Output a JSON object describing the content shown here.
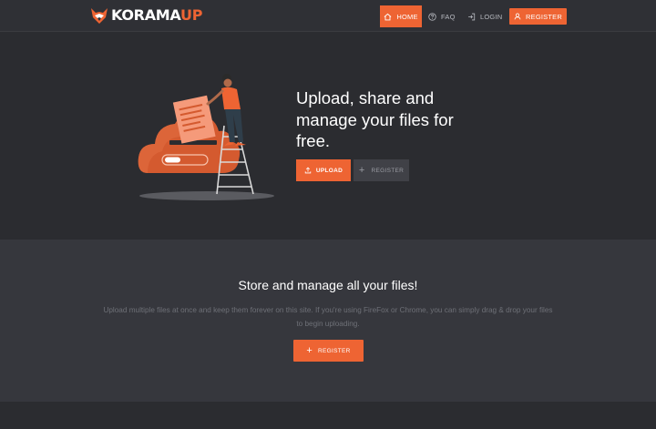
{
  "brand": {
    "name_part1": "KORAMA",
    "name_part2": "UP",
    "accent": "#ee6433"
  },
  "nav": {
    "home": "HOME",
    "faq": "FAQ",
    "login": "LOGIN",
    "register": "REGISTER"
  },
  "hero": {
    "title": "Upload, share and manage your files for free.",
    "upload_button": "UPLOAD",
    "register_button": "REGISTER"
  },
  "features": {
    "title": "Store and manage all your files!",
    "description": "Upload multiple files at once and keep them forever on this site. If you're using FireFox or Chrome, you can simply drag & drop your files to begin uploading.",
    "register_button": "REGISTER"
  },
  "colors": {
    "background": "#2b2c30",
    "section": "#36373d",
    "accent": "#ee6433"
  }
}
